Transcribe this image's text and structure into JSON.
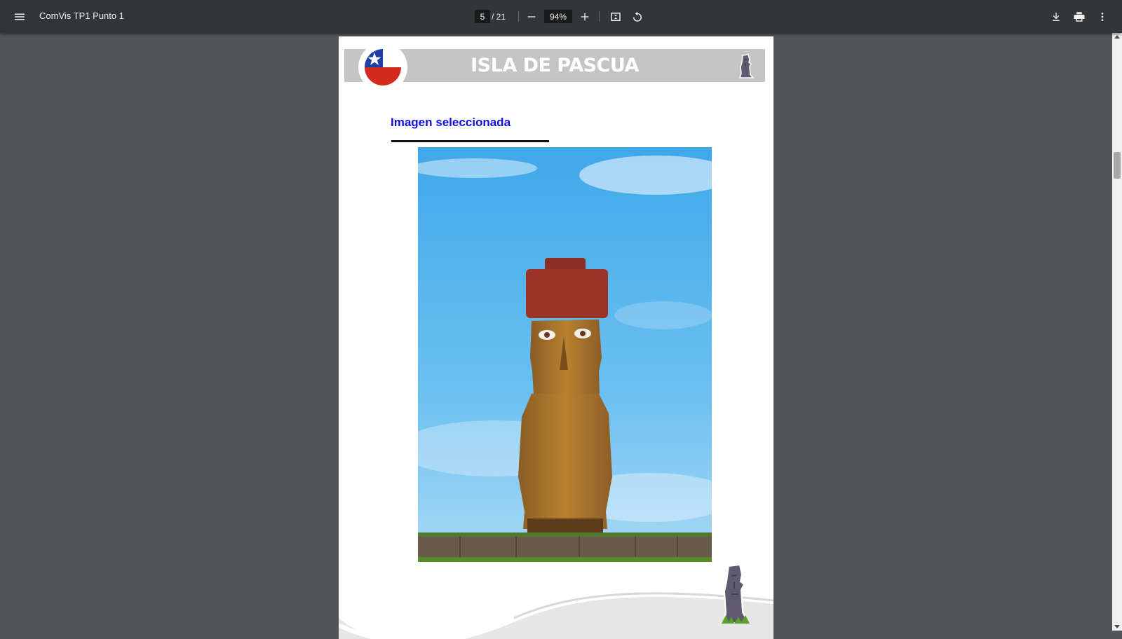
{
  "toolbar": {
    "title": "ComVis TP1 Punto 1",
    "current_page": "5",
    "total_pages": "/ 21",
    "zoom": "94%",
    "icons": {
      "menu": "menu-icon",
      "zoom_out": "minus-icon",
      "zoom_in": "plus-icon",
      "fit": "fit-to-page-icon",
      "rotate": "rotate-icon",
      "download": "download-icon",
      "print": "print-icon",
      "more": "more-vert-icon"
    }
  },
  "document": {
    "banner_title": "ISLA DE PASCUA",
    "section_heading": "Imagen seleccionada",
    "colors": {
      "banner": "#c4c4c4",
      "heading": "#1010e0",
      "flag_blue": "#1f3fa8",
      "flag_red": "#d42a1e"
    },
    "images": [
      "chile-flag-icon",
      "moai-icon",
      "moai-photo",
      "moai-illustration"
    ]
  }
}
